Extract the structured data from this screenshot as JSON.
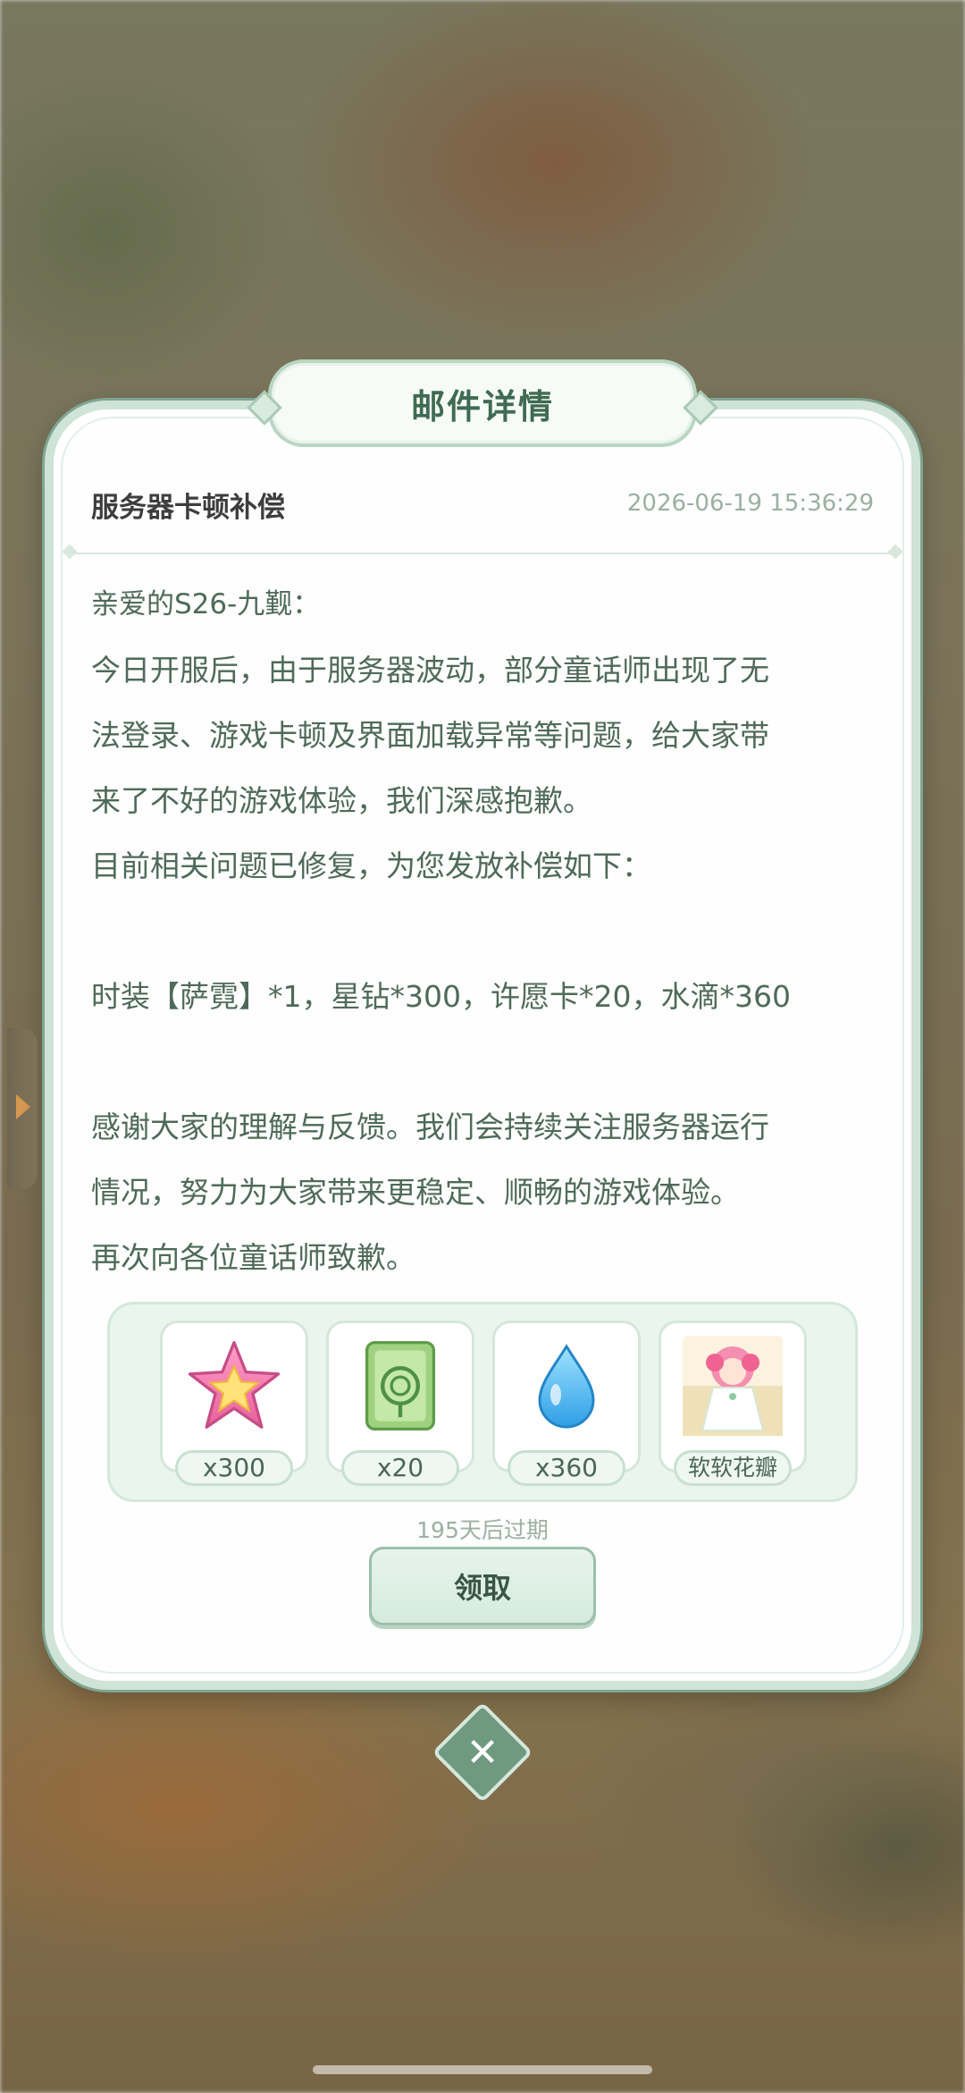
{
  "dialog": {
    "title": "邮件详情",
    "subject": "服务器卡顿补偿",
    "timestamp": "2026-06-19 15:36:29",
    "body": {
      "greeting": "亲爱的S26-九觐：",
      "lines": [
        "今日开服后，由于服务器波动，部分童话师出现了无",
        "法登录、游戏卡顿及界面加载异常等问题，给大家带",
        "来了不好的游戏体验，我们深感抱歉。",
        "目前相关问题已修复，为您发放补偿如下：",
        "",
        "时装【萨霓】*1，星钻*300，许愿卡*20，水滴*360",
        "",
        "感谢大家的理解与反馈。我们会持续关注服务器运行",
        "情况，努力为大家带来更稳定、顺畅的游戏体验。",
        "再次向各位童话师致歉。"
      ]
    },
    "rewards": [
      {
        "icon": "star-diamond-icon",
        "label": "x300"
      },
      {
        "icon": "wish-card-icon",
        "label": "x20"
      },
      {
        "icon": "water-drop-icon",
        "label": "x360"
      },
      {
        "icon": "costume-portrait-icon",
        "label": "软软花瓣"
      }
    ],
    "expire_text": "195天后过期",
    "claim_label": "领取",
    "close_symbol": "✕"
  },
  "colors": {
    "accent": "#3f6b52",
    "body_text": "#4f6a5a",
    "panel_bg": "#eaf5ee",
    "close_bg": "#6f9a80"
  }
}
